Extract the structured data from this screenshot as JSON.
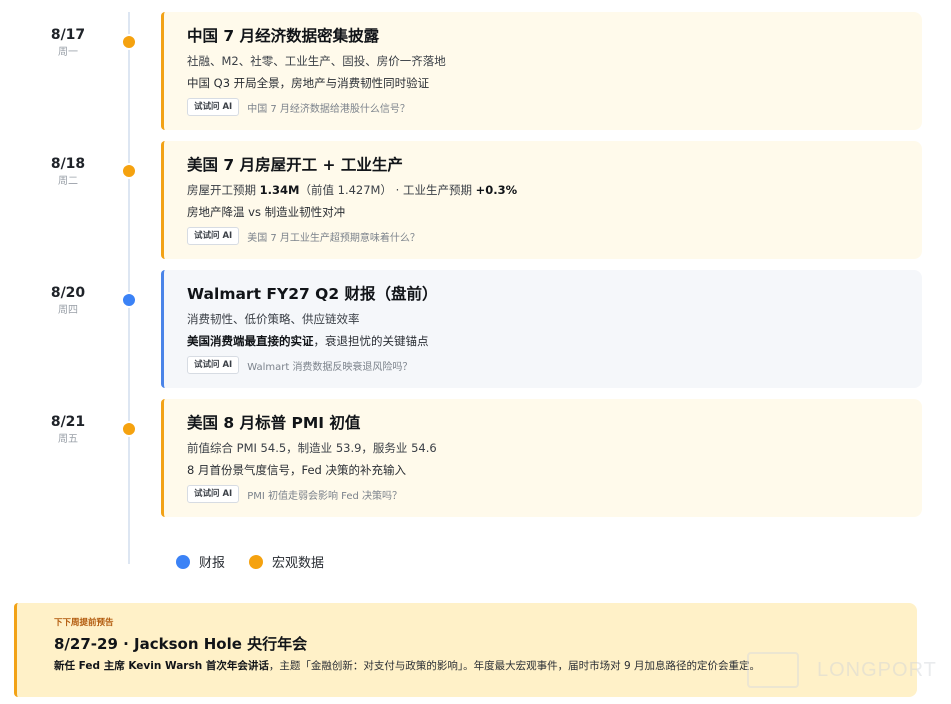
{
  "events": [
    {
      "date": "8/17",
      "weekday": "周一",
      "type": "macro",
      "title": "中国 7 月经济数据密集披露",
      "line1": [
        "社融、M2、社零、工业生产、固投、房价一齐落地"
      ],
      "line2": [
        "中国 Q3 开局全景，房地产与消费韧性同时验证"
      ],
      "ask_label": "试试问 AI",
      "ask_prompt": "中国 7 月经济数据给港股什么信号？"
    },
    {
      "date": "8/18",
      "weekday": "周二",
      "type": "macro",
      "title": "美国 7 月房屋开工 + 工业生产",
      "line1": [
        "房屋开工预期 ",
        "1.34M",
        "（前值 1.427M）  ·   工业生产预期 ",
        "+0.3%"
      ],
      "line2": [
        "房地产降温 vs 制造业韧性对冲"
      ],
      "ask_label": "试试问 AI",
      "ask_prompt": "美国 7 月工业生产超预期意味着什么？"
    },
    {
      "date": "8/20",
      "weekday": "周四",
      "type": "earnings",
      "title": "Walmart FY27 Q2 财报（盘前）",
      "line1": [
        "消费韧性、低价策略、供应链效率"
      ],
      "line2": [
        "美国消费端最直接的实证",
        "，衰退担忧的关键锚点"
      ],
      "ask_label": "试试问 AI",
      "ask_prompt": "Walmart 消费数据反映衰退风险吗？"
    },
    {
      "date": "8/21",
      "weekday": "周五",
      "type": "macro",
      "title": "美国 8 月标普 PMI 初值",
      "line1": [
        "前值综合 PMI 54.5，制造业 53.9，服务业 54.6"
      ],
      "line2": [
        "8 月首份景气度信号，Fed 决策的补充输入"
      ],
      "ask_label": "试试问 AI",
      "ask_prompt": "PMI 初值走弱会影响 Fed 决策吗？"
    }
  ],
  "legend": {
    "earnings_label": "财报",
    "macro_label": "宏观数据",
    "earnings_color": "#3b82f6",
    "macro_color": "#f5a20f"
  },
  "preview": {
    "label": "下下周提前预告",
    "title": "8/27-29 · Jackson Hole 央行年会",
    "desc_bold": "新任 Fed 主席 Kevin Warsh 首次年会讲话",
    "desc_rest": "，主题「金融创新：对支付与政策的影响」。年度最大宏观事件，届时市场对 9 月加息路径的定价会重定。"
  },
  "watermark": "LONGPORT"
}
